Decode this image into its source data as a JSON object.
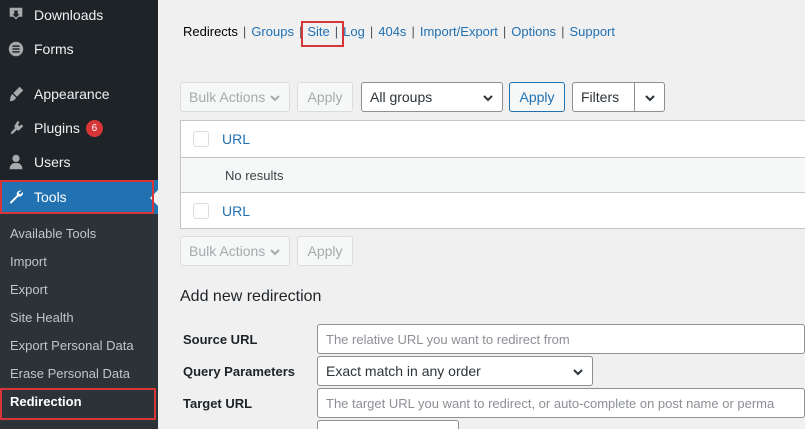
{
  "sidebar": {
    "menu": [
      {
        "label": "Downloads",
        "icon": "download-icon"
      },
      {
        "label": "Forms",
        "icon": "forms-icon"
      },
      {
        "label": "Appearance",
        "icon": "appearance-icon"
      },
      {
        "label": "Plugins",
        "icon": "plugins-icon",
        "badge": "6"
      },
      {
        "label": "Users",
        "icon": "users-icon"
      },
      {
        "label": "Tools",
        "icon": "wrench-icon",
        "current": true
      }
    ],
    "submenu": [
      {
        "label": "Available Tools"
      },
      {
        "label": "Import"
      },
      {
        "label": "Export"
      },
      {
        "label": "Site Health"
      },
      {
        "label": "Export Personal Data"
      },
      {
        "label": "Erase Personal Data"
      },
      {
        "label": "Redirection",
        "active": true
      }
    ]
  },
  "nav": {
    "items": [
      "Redirects",
      "Groups",
      "Site",
      "Log",
      "404s",
      "Import/Export",
      "Options",
      "Support"
    ],
    "current": "Redirects"
  },
  "toolbar": {
    "bulk_actions": "Bulk Actions",
    "apply": "Apply",
    "group_select": "All groups",
    "apply_filter": "Apply",
    "filters": "Filters"
  },
  "table": {
    "header": "URL",
    "empty": "No results",
    "footer": "URL"
  },
  "bottom_toolbar": {
    "bulk_actions": "Bulk Actions",
    "apply": "Apply"
  },
  "form": {
    "title": "Add new redirection",
    "source_label": "Source URL",
    "source_placeholder": "The relative URL you want to redirect from",
    "query_label": "Query Parameters",
    "query_value": "Exact match in any order",
    "target_label": "Target URL",
    "target_placeholder": "The target URL you want to redirect, or auto-complete on post name or perma"
  },
  "colors": {
    "sidebar_bg": "#1d2327",
    "accent": "#2271b1",
    "highlight": "#d63638"
  }
}
